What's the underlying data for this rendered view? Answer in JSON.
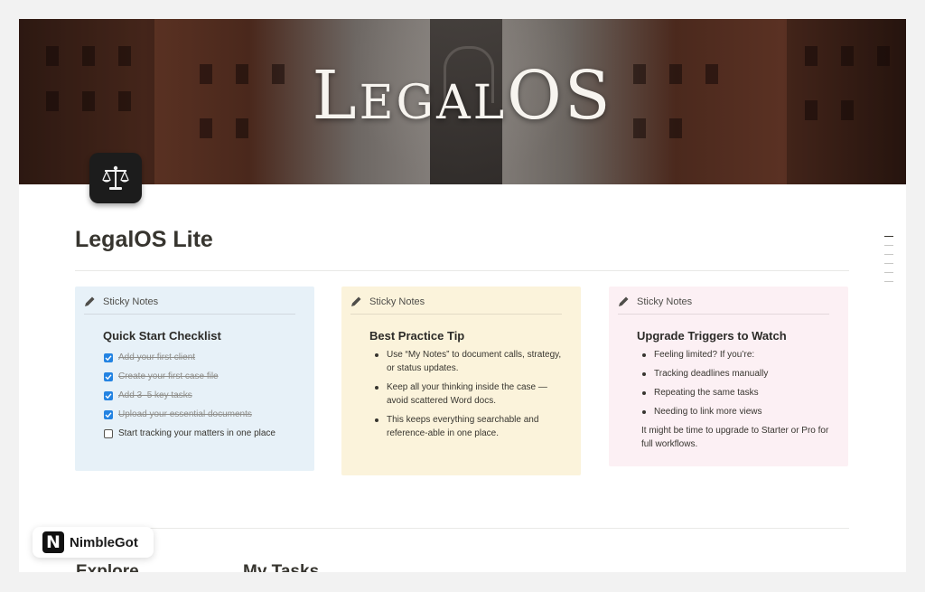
{
  "cover": {
    "title": "LegalOS"
  },
  "page": {
    "title": "LegalOS Lite",
    "icon": "scales-of-justice-icon"
  },
  "cards": [
    {
      "header": "Sticky Notes",
      "title": "Quick Start Checklist",
      "color": "#e7f1f8",
      "checklist": [
        {
          "label": "Add your first client",
          "checked": true
        },
        {
          "label": "Create your first case file",
          "checked": true
        },
        {
          "label": "Add 3–5 key tasks",
          "checked": true
        },
        {
          "label": "Upload your essential documents",
          "checked": true
        },
        {
          "label": "Start tracking your matters in one place",
          "checked": false
        }
      ]
    },
    {
      "header": "Sticky Notes",
      "title": "Best Practice Tip",
      "color": "#fbf3db",
      "bullets": [
        "Use “My Notes” to document calls, strategy, or status updates.",
        "Keep all your thinking inside the case — avoid scattered Word docs.",
        "This keeps everything searchable and reference-able in one place."
      ]
    },
    {
      "header": "Sticky Notes",
      "title": "Upgrade Triggers to Watch",
      "color": "#fcf0f4",
      "bullets": [
        "Feeling limited? If you’re:",
        "Tracking deadlines manually",
        "Repeating the same tasks",
        "Needing to link more views"
      ],
      "note": "It might be time to upgrade to Starter or Pro for full workflows."
    }
  ],
  "sections": {
    "explore": "Explore",
    "my_tasks": "My Tasks"
  },
  "badge": {
    "logo_letter": "N",
    "text": "NimbleGot"
  },
  "colors": {
    "checkbox": "#2383e2",
    "text": "#37352f"
  }
}
